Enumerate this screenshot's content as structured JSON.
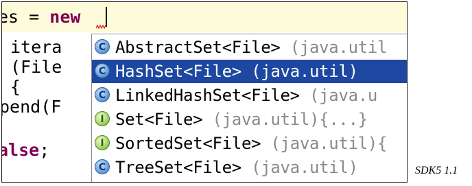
{
  "editor": {
    "line1": {
      "prefix": "es = ",
      "keyword": "new"
    },
    "line2": "itera",
    "line3": "(File",
    "line4": "{",
    "line5": "pend(F",
    "line7": {
      "keyword": "alse",
      "suffix": ";"
    }
  },
  "completion": {
    "items": [
      {
        "type_text": "AbstractSet<File>",
        "package_text": " (java.util",
        "icon": "class-icon",
        "icon_letter": "C",
        "selected": false
      },
      {
        "type_text": "HashSet<File>",
        "package_text": " (java.util)",
        "icon": "class-icon",
        "icon_letter": "C",
        "selected": true
      },
      {
        "type_text": "LinkedHashSet<File>",
        "package_text": " (java.u",
        "icon": "class-icon",
        "icon_letter": "C",
        "selected": false
      },
      {
        "type_text": "Set<File>",
        "package_text": " (java.util){...}",
        "icon": "interface-icon",
        "icon_letter": "I",
        "selected": false
      },
      {
        "type_text": "SortedSet<File>",
        "package_text": " (java.util){",
        "icon": "interface-icon",
        "icon_letter": "I",
        "selected": false
      },
      {
        "type_text": "TreeSet<File>",
        "package_text": " (java.util)",
        "icon": "class-icon",
        "icon_letter": "C",
        "selected": false
      }
    ]
  },
  "caption": "SDK5 1.1",
  "colors": {
    "keyword": "#7f0055",
    "selection": "#1d47a0",
    "current_line": "#fdfbd9",
    "package_text": "#8a8a8a"
  }
}
